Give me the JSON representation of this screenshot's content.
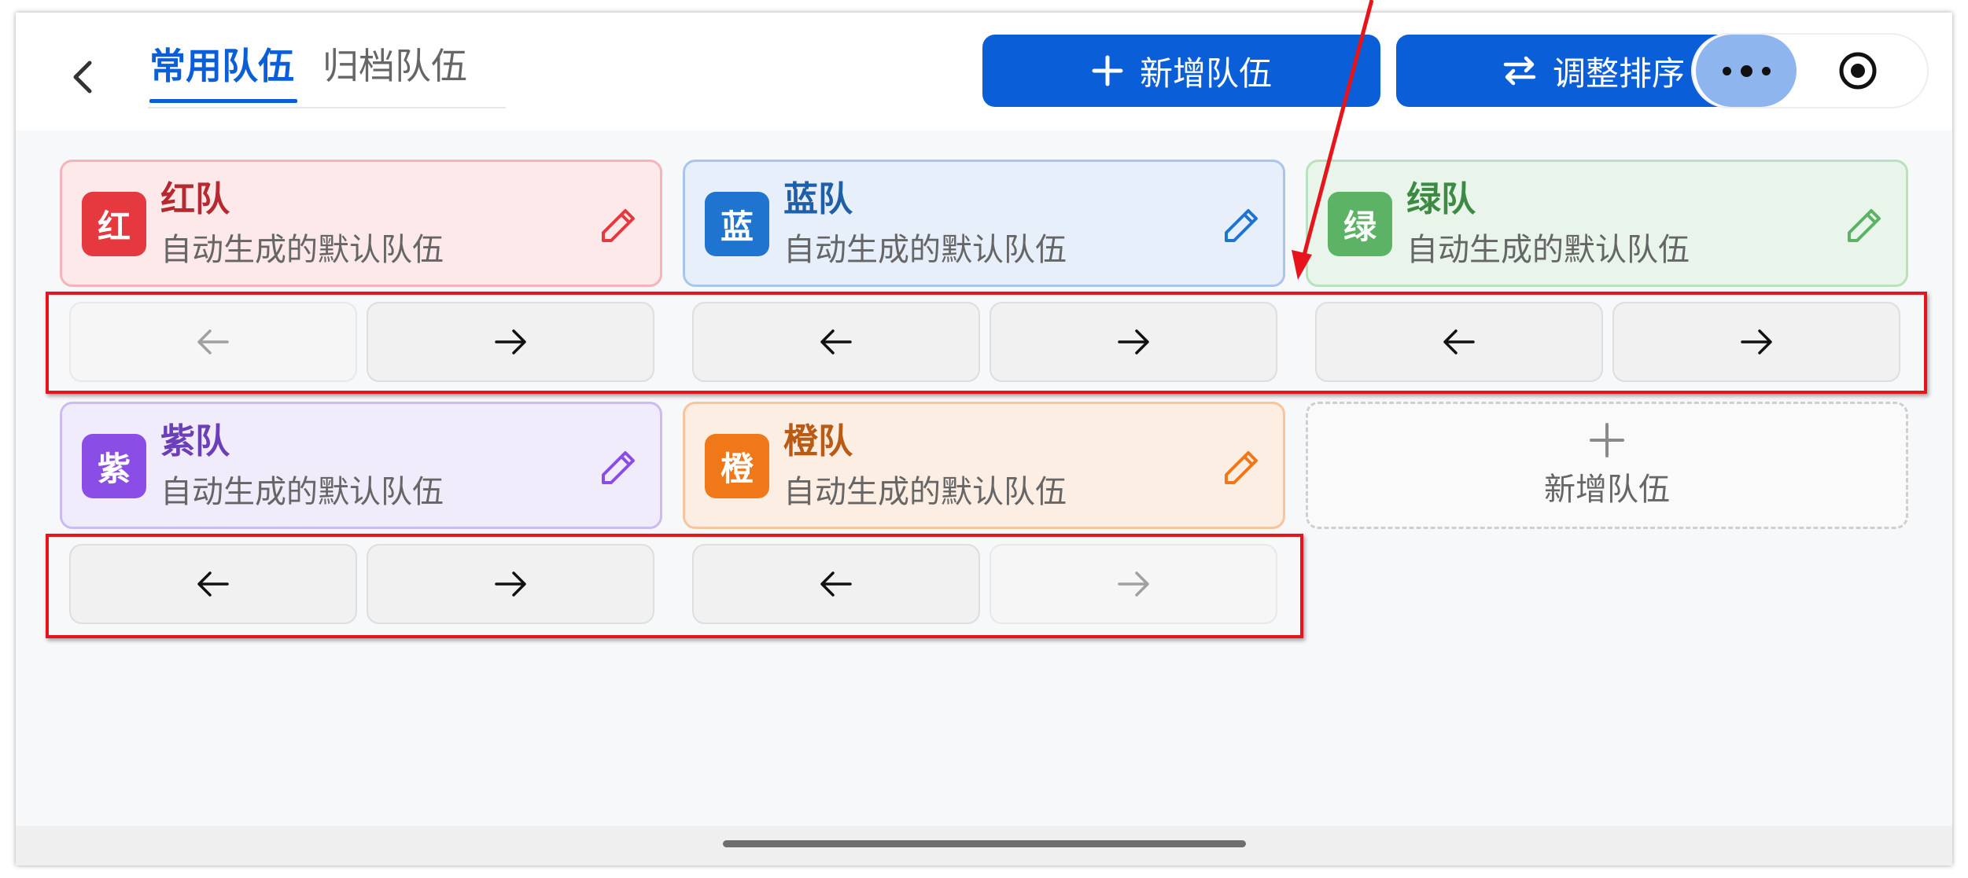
{
  "header": {
    "back_icon": "chevron-left-icon",
    "tabs": [
      {
        "label": "常用队伍",
        "active": true
      },
      {
        "label": "归档队伍",
        "active": false
      }
    ],
    "add_team_label": "新增队伍",
    "add_team_icon": "plus-icon",
    "sort_label": "调整排序",
    "sort_icon": "swap-arrows-icon",
    "more_icon": "more-dots-icon",
    "target_icon": "target-icon"
  },
  "teams": [
    {
      "badge": "红",
      "name": "红队",
      "desc": "自动生成的默认队伍",
      "color": "#e5383f",
      "edit_icon": "pencil-icon"
    },
    {
      "badge": "蓝",
      "name": "蓝队",
      "desc": "自动生成的默认队伍",
      "color": "#1f74d0",
      "edit_icon": "pencil-icon"
    },
    {
      "badge": "绿",
      "name": "绿队",
      "desc": "自动生成的默认队伍",
      "color": "#5cb265",
      "edit_icon": "pencil-icon"
    },
    {
      "badge": "紫",
      "name": "紫队",
      "desc": "自动生成的默认队伍",
      "color": "#8a4ee6",
      "edit_icon": "pencil-icon"
    },
    {
      "badge": "橙",
      "name": "橙队",
      "desc": "自动生成的默认队伍",
      "color": "#f07818",
      "edit_icon": "pencil-icon"
    }
  ],
  "add_card": {
    "icon": "plus-icon",
    "label": "新增队伍"
  },
  "move_buttons": [
    {
      "team": "红队",
      "left_enabled": false,
      "right_enabled": true
    },
    {
      "team": "蓝队",
      "left_enabled": true,
      "right_enabled": true
    },
    {
      "team": "绿队",
      "left_enabled": true,
      "right_enabled": true
    },
    {
      "team": "紫队",
      "left_enabled": true,
      "right_enabled": true
    },
    {
      "team": "橙队",
      "left_enabled": true,
      "right_enabled": false
    }
  ],
  "annotation": {
    "color": "#e8141b"
  }
}
